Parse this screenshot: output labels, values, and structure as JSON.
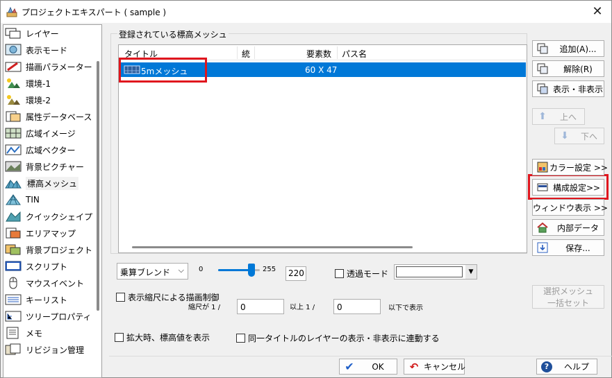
{
  "window": {
    "title": "プロジェクトエキスパート ( sample )"
  },
  "sidebar": {
    "items": [
      {
        "label": "レイヤー",
        "icon": "layers-icon"
      },
      {
        "label": "表示モード",
        "icon": "display-mode-icon"
      },
      {
        "label": "描画パラメーター",
        "icon": "draw-parameter-icon"
      },
      {
        "label": "環境-1",
        "icon": "environment-icon"
      },
      {
        "label": "環境-2",
        "icon": "environment-icon"
      },
      {
        "label": "属性データベース",
        "icon": "attribute-database-icon"
      },
      {
        "label": "広域イメージ",
        "icon": "wide-image-icon"
      },
      {
        "label": "広域ベクター",
        "icon": "wide-vector-icon"
      },
      {
        "label": "背景ピクチャー",
        "icon": "background-picture-icon"
      },
      {
        "label": "標高メッシュ",
        "icon": "elevation-mesh-icon"
      },
      {
        "label": "TIN",
        "icon": "tin-icon"
      },
      {
        "label": "クイックシェイプ",
        "icon": "quick-shape-icon"
      },
      {
        "label": "エリアマップ",
        "icon": "area-map-icon"
      },
      {
        "label": "背景プロジェクト",
        "icon": "background-project-icon"
      },
      {
        "label": "スクリプト",
        "icon": "script-icon"
      },
      {
        "label": "マウスイベント",
        "icon": "mouse-icon"
      },
      {
        "label": "キーリスト",
        "icon": "key-list-icon"
      },
      {
        "label": "ツリープロパティ",
        "icon": "tree-property-icon"
      },
      {
        "label": "メモ",
        "icon": "memo-icon"
      },
      {
        "label": "リビジョン管理",
        "icon": "revision-icon"
      }
    ],
    "selected_index": 9
  },
  "mesh_group": {
    "label": "登録されている標高メッシュ",
    "columns": [
      "タイトル",
      "統",
      "要素数",
      "パス名"
    ],
    "rows": [
      {
        "title": "5mメッシュ",
        "kind": "",
        "count": "60 X 47",
        "path": ""
      }
    ]
  },
  "buttons": {
    "add": "追加(A)...",
    "remove": "解除(R)",
    "show_hide": "表示・非表示",
    "up": "上へ",
    "down": "下へ",
    "color_settings": "カラー設定 >>",
    "config_settings": "構成設定>>",
    "window_display": "ウィンドウ表示 >>",
    "internal_data": "内部データ",
    "save": "保存...",
    "batch_set_1": "選択メッシュ",
    "batch_set_2": "一括セット"
  },
  "blend": {
    "mode": "乗算ブレンド",
    "min_label": "0",
    "max_label": "255",
    "value": "220",
    "level": 220
  },
  "transparent": {
    "label": "透過モード",
    "checked": false,
    "color_value": ""
  },
  "scale_control": {
    "label": "表示縮尺による描画制御",
    "checked": false,
    "scale_prefix": "縮尺が 1 /",
    "from_value": "0",
    "above_label": "以上  1 /",
    "to_value": "0",
    "below_label": "以下で表示"
  },
  "options": {
    "show_elevation": "拡大時、標高値を表示",
    "link_layers": "同一タイトルのレイヤーの表示・非表示に連動する"
  },
  "footer": {
    "ok": "OK",
    "cancel": "キャンセル",
    "help": "ヘルプ"
  },
  "colors": {
    "selection": "#0078d7",
    "highlight_box": "#e0161e"
  }
}
